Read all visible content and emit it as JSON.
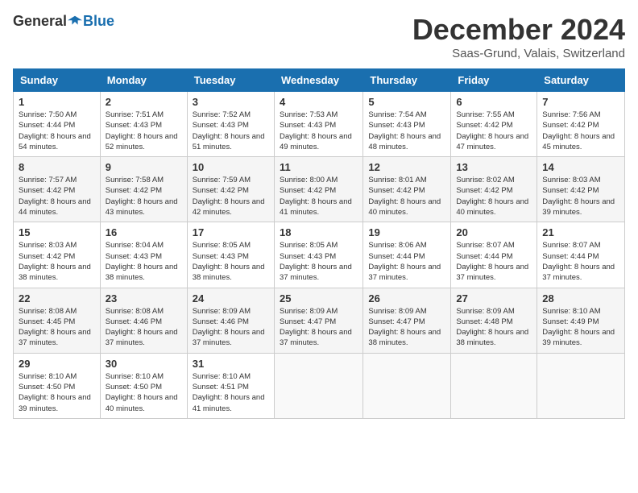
{
  "header": {
    "logo_general": "General",
    "logo_blue": "Blue",
    "title": "December 2024",
    "location": "Saas-Grund, Valais, Switzerland"
  },
  "weekdays": [
    "Sunday",
    "Monday",
    "Tuesday",
    "Wednesday",
    "Thursday",
    "Friday",
    "Saturday"
  ],
  "weeks": [
    [
      {
        "day": "1",
        "sunrise": "7:50 AM",
        "sunset": "4:44 PM",
        "daylight": "8 hours and 54 minutes."
      },
      {
        "day": "2",
        "sunrise": "7:51 AM",
        "sunset": "4:43 PM",
        "daylight": "8 hours and 52 minutes."
      },
      {
        "day": "3",
        "sunrise": "7:52 AM",
        "sunset": "4:43 PM",
        "daylight": "8 hours and 51 minutes."
      },
      {
        "day": "4",
        "sunrise": "7:53 AM",
        "sunset": "4:43 PM",
        "daylight": "8 hours and 49 minutes."
      },
      {
        "day": "5",
        "sunrise": "7:54 AM",
        "sunset": "4:43 PM",
        "daylight": "8 hours and 48 minutes."
      },
      {
        "day": "6",
        "sunrise": "7:55 AM",
        "sunset": "4:42 PM",
        "daylight": "8 hours and 47 minutes."
      },
      {
        "day": "7",
        "sunrise": "7:56 AM",
        "sunset": "4:42 PM",
        "daylight": "8 hours and 45 minutes."
      }
    ],
    [
      {
        "day": "8",
        "sunrise": "7:57 AM",
        "sunset": "4:42 PM",
        "daylight": "8 hours and 44 minutes."
      },
      {
        "day": "9",
        "sunrise": "7:58 AM",
        "sunset": "4:42 PM",
        "daylight": "8 hours and 43 minutes."
      },
      {
        "day": "10",
        "sunrise": "7:59 AM",
        "sunset": "4:42 PM",
        "daylight": "8 hours and 42 minutes."
      },
      {
        "day": "11",
        "sunrise": "8:00 AM",
        "sunset": "4:42 PM",
        "daylight": "8 hours and 41 minutes."
      },
      {
        "day": "12",
        "sunrise": "8:01 AM",
        "sunset": "4:42 PM",
        "daylight": "8 hours and 40 minutes."
      },
      {
        "day": "13",
        "sunrise": "8:02 AM",
        "sunset": "4:42 PM",
        "daylight": "8 hours and 40 minutes."
      },
      {
        "day": "14",
        "sunrise": "8:03 AM",
        "sunset": "4:42 PM",
        "daylight": "8 hours and 39 minutes."
      }
    ],
    [
      {
        "day": "15",
        "sunrise": "8:03 AM",
        "sunset": "4:42 PM",
        "daylight": "8 hours and 38 minutes."
      },
      {
        "day": "16",
        "sunrise": "8:04 AM",
        "sunset": "4:43 PM",
        "daylight": "8 hours and 38 minutes."
      },
      {
        "day": "17",
        "sunrise": "8:05 AM",
        "sunset": "4:43 PM",
        "daylight": "8 hours and 38 minutes."
      },
      {
        "day": "18",
        "sunrise": "8:05 AM",
        "sunset": "4:43 PM",
        "daylight": "8 hours and 37 minutes."
      },
      {
        "day": "19",
        "sunrise": "8:06 AM",
        "sunset": "4:44 PM",
        "daylight": "8 hours and 37 minutes."
      },
      {
        "day": "20",
        "sunrise": "8:07 AM",
        "sunset": "4:44 PM",
        "daylight": "8 hours and 37 minutes."
      },
      {
        "day": "21",
        "sunrise": "8:07 AM",
        "sunset": "4:44 PM",
        "daylight": "8 hours and 37 minutes."
      }
    ],
    [
      {
        "day": "22",
        "sunrise": "8:08 AM",
        "sunset": "4:45 PM",
        "daylight": "8 hours and 37 minutes."
      },
      {
        "day": "23",
        "sunrise": "8:08 AM",
        "sunset": "4:46 PM",
        "daylight": "8 hours and 37 minutes."
      },
      {
        "day": "24",
        "sunrise": "8:09 AM",
        "sunset": "4:46 PM",
        "daylight": "8 hours and 37 minutes."
      },
      {
        "day": "25",
        "sunrise": "8:09 AM",
        "sunset": "4:47 PM",
        "daylight": "8 hours and 37 minutes."
      },
      {
        "day": "26",
        "sunrise": "8:09 AM",
        "sunset": "4:47 PM",
        "daylight": "8 hours and 38 minutes."
      },
      {
        "day": "27",
        "sunrise": "8:09 AM",
        "sunset": "4:48 PM",
        "daylight": "8 hours and 38 minutes."
      },
      {
        "day": "28",
        "sunrise": "8:10 AM",
        "sunset": "4:49 PM",
        "daylight": "8 hours and 39 minutes."
      }
    ],
    [
      {
        "day": "29",
        "sunrise": "8:10 AM",
        "sunset": "4:50 PM",
        "daylight": "8 hours and 39 minutes."
      },
      {
        "day": "30",
        "sunrise": "8:10 AM",
        "sunset": "4:50 PM",
        "daylight": "8 hours and 40 minutes."
      },
      {
        "day": "31",
        "sunrise": "8:10 AM",
        "sunset": "4:51 PM",
        "daylight": "8 hours and 41 minutes."
      },
      null,
      null,
      null,
      null
    ]
  ],
  "labels": {
    "sunrise": "Sunrise:",
    "sunset": "Sunset:",
    "daylight": "Daylight:"
  }
}
